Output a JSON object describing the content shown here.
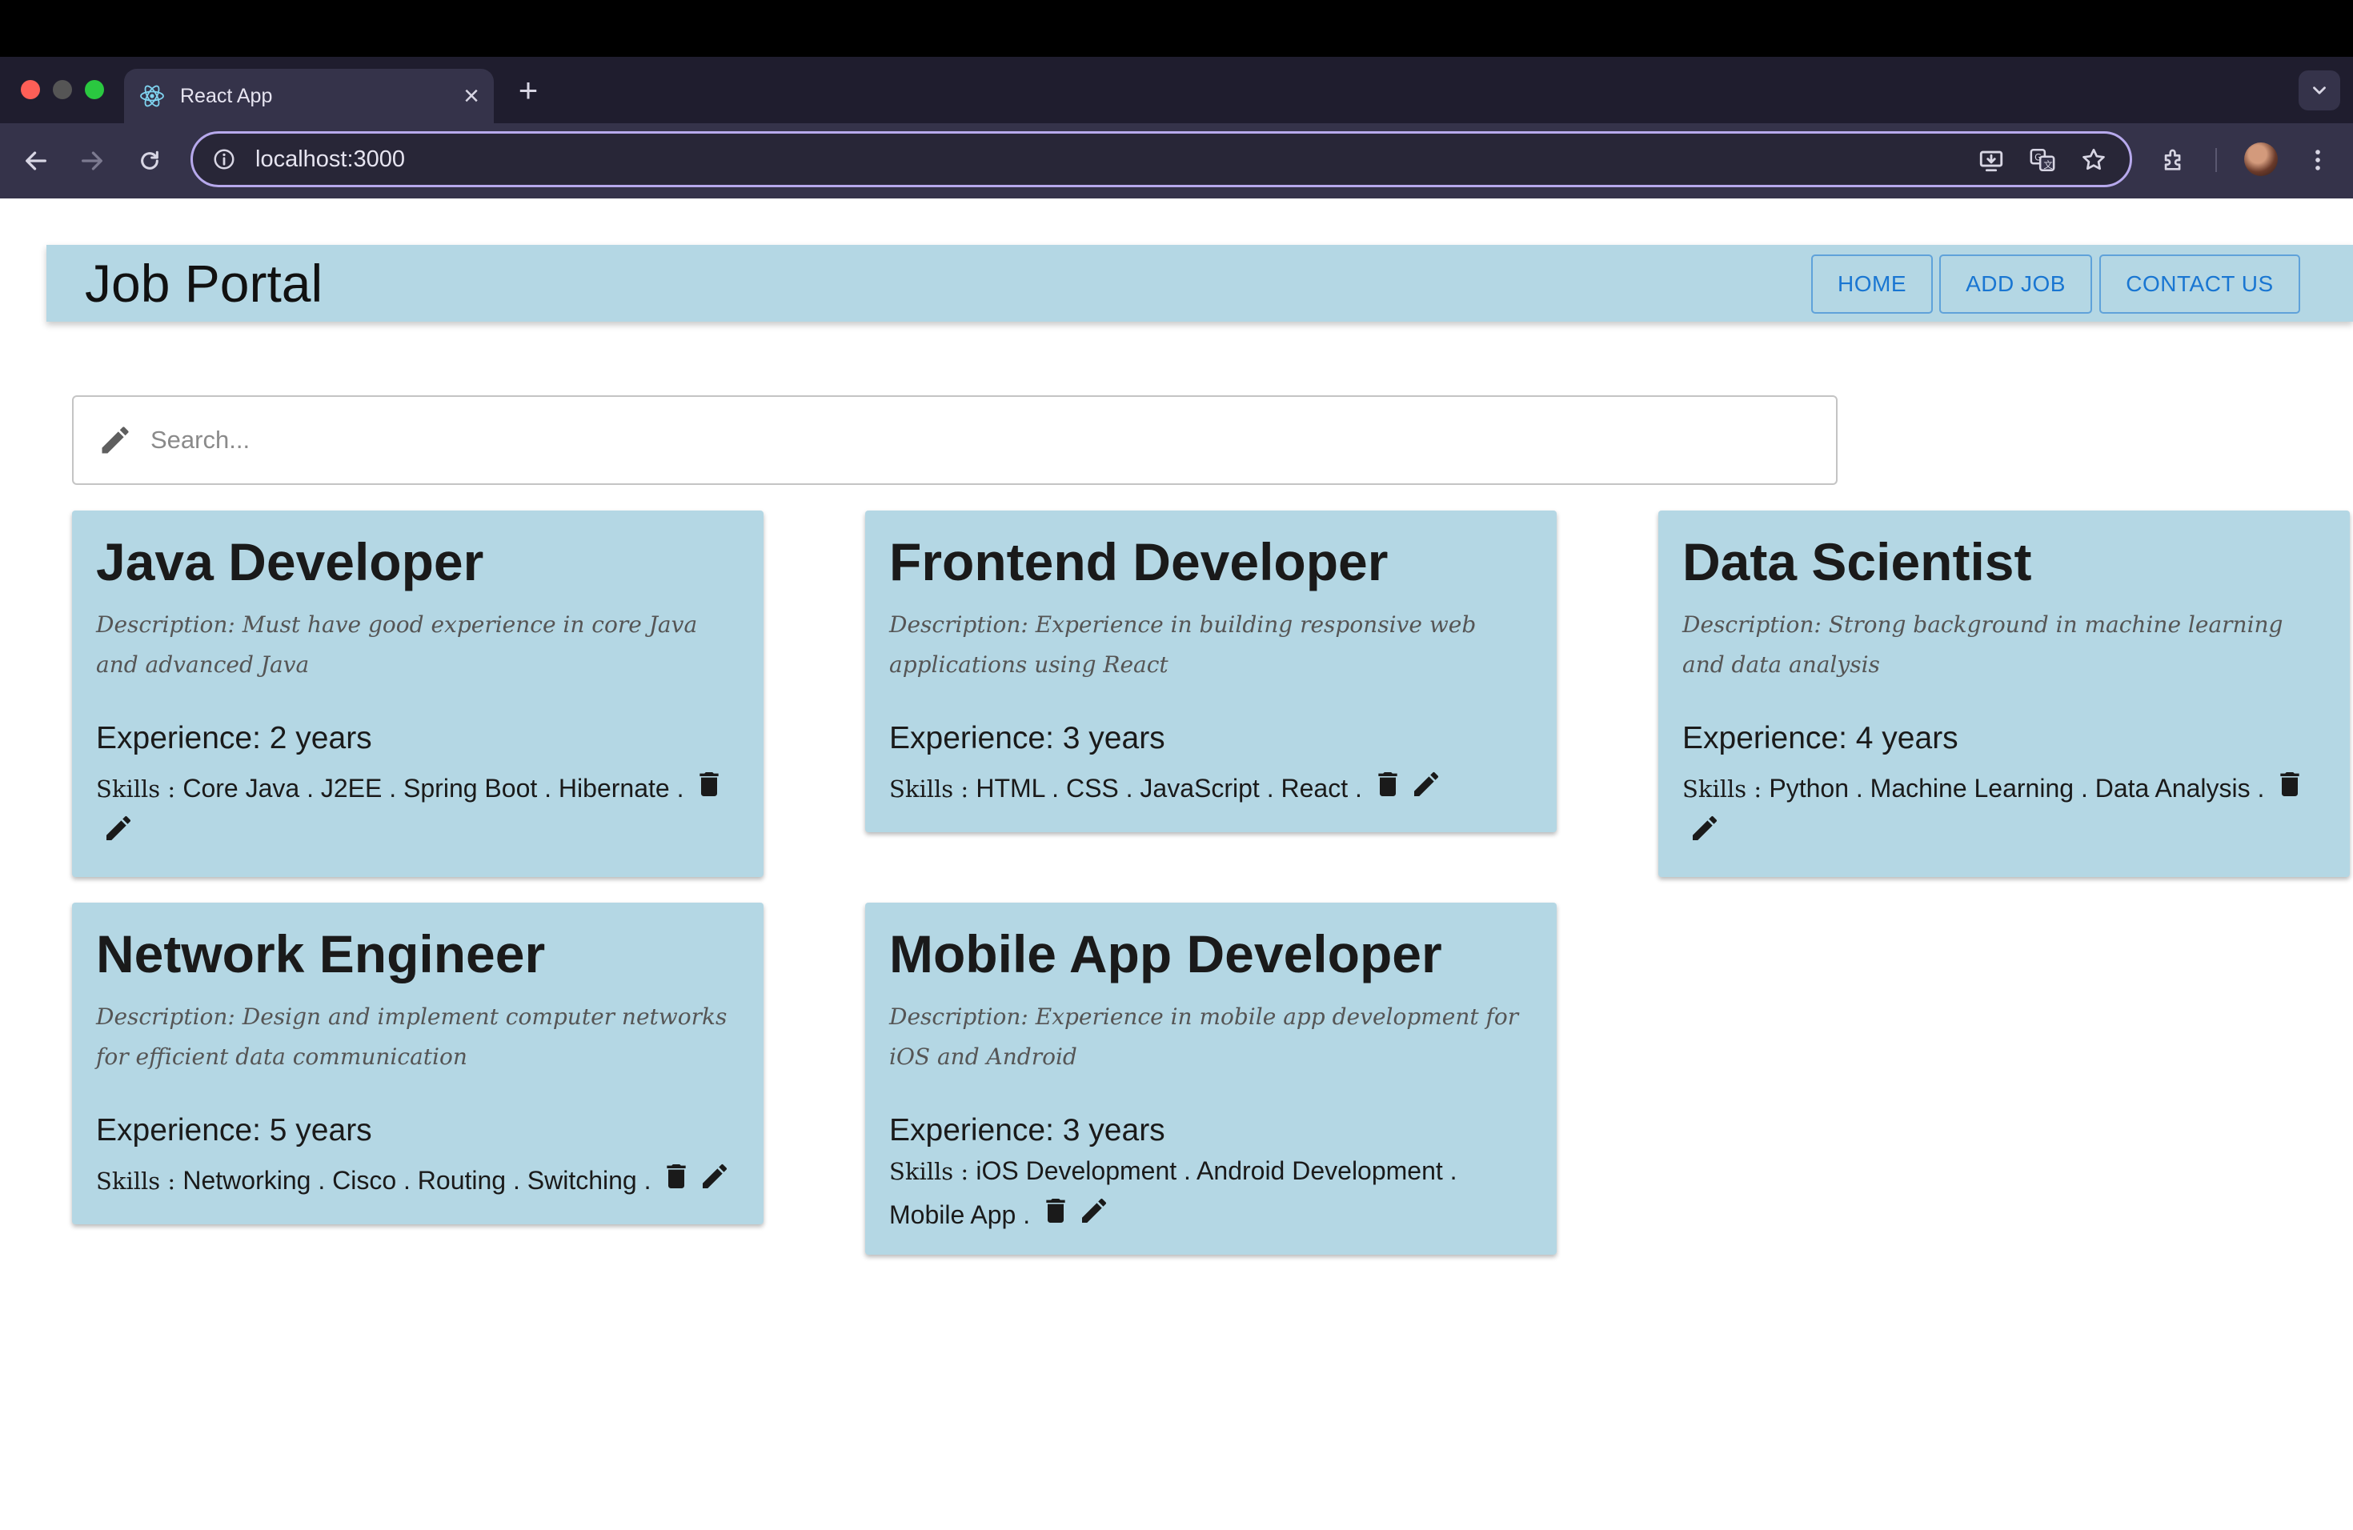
{
  "browser": {
    "tab_title": "React App",
    "tab_close": "×",
    "new_tab": "+",
    "url": "localhost:3000"
  },
  "header": {
    "title": "Job Portal",
    "nav": [
      "HOME",
      "ADD JOB",
      "CONTACT US"
    ]
  },
  "search": {
    "placeholder": "Search..."
  },
  "jobs": [
    {
      "title": "Java Developer",
      "description": "Description: Must have good experience in core Java and advanced Java",
      "experience": "Experience: 2 years",
      "skills_label": "Skills : ",
      "skills": "Core Java . J2EE . Spring Boot . Hibernate ."
    },
    {
      "title": "Frontend Developer",
      "description": "Description: Experience in building responsive web applications using React",
      "experience": "Experience: 3 years",
      "skills_label": "Skills : ",
      "skills": "HTML . CSS . JavaScript . React ."
    },
    {
      "title": "Data Scientist",
      "description": "Description: Strong background in machine learning and data analysis",
      "experience": "Experience: 4 years",
      "skills_label": "Skills : ",
      "skills": "Python . Machine Learning . Data Analysis ."
    },
    {
      "title": "Network Engineer",
      "description": "Description: Design and implement computer networks for efficient data communication",
      "experience": "Experience: 5 years",
      "skills_label": "Skills : ",
      "skills": "Networking . Cisco . Routing . Switching ."
    },
    {
      "title": "Mobile App Developer",
      "description": "Description: Experience in mobile app development for iOS and Android",
      "experience": "Experience: 3 years",
      "skills_label": "Skills : ",
      "skills": "iOS Development . Android Development . Mobile App ."
    }
  ],
  "colors": {
    "card_bg": "#b4d7e4",
    "nav_accent": "#1976d2",
    "omnibox_focus": "#b7a9ec"
  },
  "icons": [
    "react-favicon-icon",
    "close-icon",
    "plus-icon",
    "chevron-down-icon",
    "back-arrow-icon",
    "forward-arrow-icon",
    "reload-icon",
    "site-info-icon",
    "install-app-icon",
    "translate-icon",
    "bookmark-star-icon",
    "extensions-icon",
    "kebab-menu-icon",
    "pencil-icon",
    "delete-icon",
    "edit-icon"
  ]
}
